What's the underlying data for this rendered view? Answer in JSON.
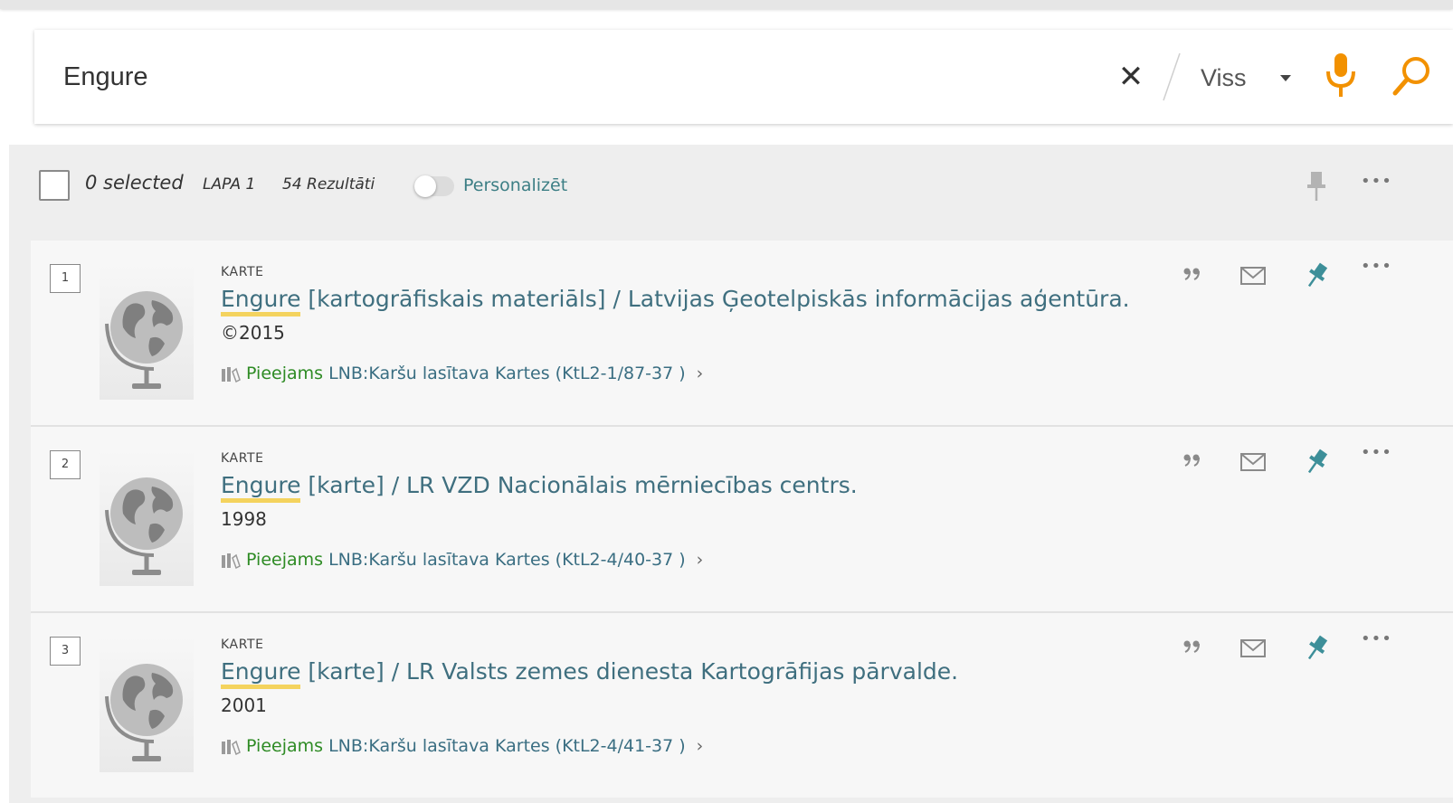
{
  "search": {
    "query": "Engure",
    "clear_icon": "close-icon",
    "scope": "Viss",
    "mic_icon": "microphone-icon",
    "search_icon": "search-icon"
  },
  "toolbar": {
    "selected": "0 selected",
    "page": "LAPA 1",
    "results": "54 Rezultāti",
    "personalize": "Personalizēt",
    "personalize_on": false
  },
  "results": [
    {
      "num": "1",
      "type": "KARTE",
      "title_highlight": "Engure",
      "title_rest": " [kartogrāfiskais materiāls] / Latvijas Ģeotelpiskās informācijas aģentūra.",
      "year": "©2015",
      "status": "Pieejams",
      "location": "LNB:Karšu lasītava  Kartes (KtL2-1/87-37 )"
    },
    {
      "num": "2",
      "type": "KARTE",
      "title_highlight": "Engure",
      "title_rest": " [karte] / LR VZD Nacionālais mērniecības centrs.",
      "year": "1998",
      "status": "Pieejams",
      "location": "LNB:Karšu lasītava  Kartes (KtL2-4/40-37 )"
    },
    {
      "num": "3",
      "type": "KARTE",
      "title_highlight": "Engure",
      "title_rest": " [karte] / LR Valsts zemes dienesta Kartogrāfijas pārvalde.",
      "year": "2001",
      "status": "Pieejams",
      "location": "LNB:Karšu lasītava  Kartes (KtL2-4/41-37 )"
    }
  ],
  "colors": {
    "accent": "#f29100",
    "link": "#3f6f7f",
    "available": "#2e8b24",
    "pin_active": "#3d8f99",
    "highlight": "#f4d35e"
  }
}
